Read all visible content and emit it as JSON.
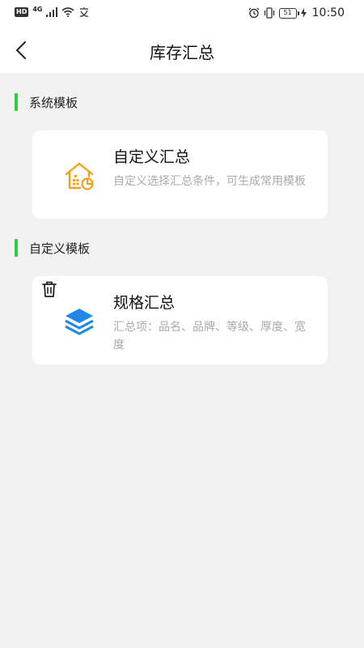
{
  "status_bar": {
    "hd": "HD",
    "network": "4G",
    "battery": "51",
    "time": "10:50"
  },
  "header": {
    "title": "库存汇总"
  },
  "sections": {
    "system": {
      "label": "系统模板",
      "card": {
        "title": "自定义汇总",
        "description": "自定义选择汇总条件，可生成常用模板",
        "icon": "house-chart-icon"
      }
    },
    "custom": {
      "label": "自定义模板",
      "card": {
        "title": "规格汇总",
        "description": "汇总项：品名、品牌、等级、厚度、宽度",
        "icon": "layers-icon"
      }
    }
  },
  "colors": {
    "accent_green": "#2ecc40",
    "icon_orange": "#f0a01c",
    "icon_blue": "#1e88e5",
    "page_bg": "#f1f1f1"
  }
}
